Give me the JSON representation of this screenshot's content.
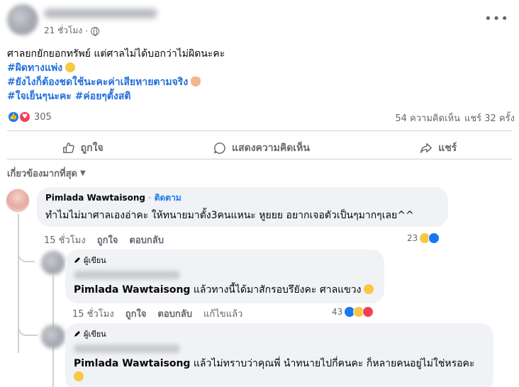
{
  "post": {
    "time": "21 ชั่วโมง",
    "dot": "·",
    "more": "•••",
    "lines": [
      "ศาลยกยักยอกทรัพย์ แต่ศาลไม่ได้บอกว่าไม่ผิดนะคะ"
    ],
    "hashtags": [
      "#ผิดทางแพ่ง",
      "#ยังไงก็ต้องชดใช้นะคะค่าเสียหายตามจริง",
      "#ใจเย็นๆนะคะ #ค่อยๆตั้งสติ"
    ],
    "reaction_count": "305",
    "comments_count": "54 ความคิดเห็น",
    "shares_count": "แชร์ 32 ครั้ง"
  },
  "actions": {
    "like": "ถูกใจ",
    "comment": "แสดงความคิดเห็น",
    "share": "แชร์"
  },
  "sort_label": "เกี่ยวข้องมากที่สุด",
  "comments": [
    {
      "name": "Pimlada Wawtaisong",
      "dot": "·",
      "follow": "ติดตาม",
      "text": "ทำไมไม่มาศาลเองอ่าคะ ให้ทนายมาตั้ง3คนแหนะ หูยยย อยากเจอตัวเป็นๆมากๆเลย^^",
      "time": "15 ชั่วโมง",
      "like": "ถูกใจ",
      "reply": "ตอบกลับ",
      "reactions": "23"
    },
    {
      "author_badge": "ผู้เขียน",
      "mention": "Pimlada Wawtaisong",
      "text": " แล้วทางนี้ได้มาสักรอบรึยังคะ ศาลแขวง",
      "time": "15 ชั่วโมง",
      "like": "ถูกใจ",
      "reply": "ตอบกลับ",
      "edited": "แก้ไขแล้ว",
      "reactions": "43"
    },
    {
      "author_badge": "ผู้เขียน",
      "mention": "Pimlada Wawtaisong",
      "text": " แล้วไม่ทราบว่าคุณพี่ นำทนายไปกี่คนคะ ก็หลายคนอยู่ไม่ใช่หรอคะ"
    }
  ]
}
